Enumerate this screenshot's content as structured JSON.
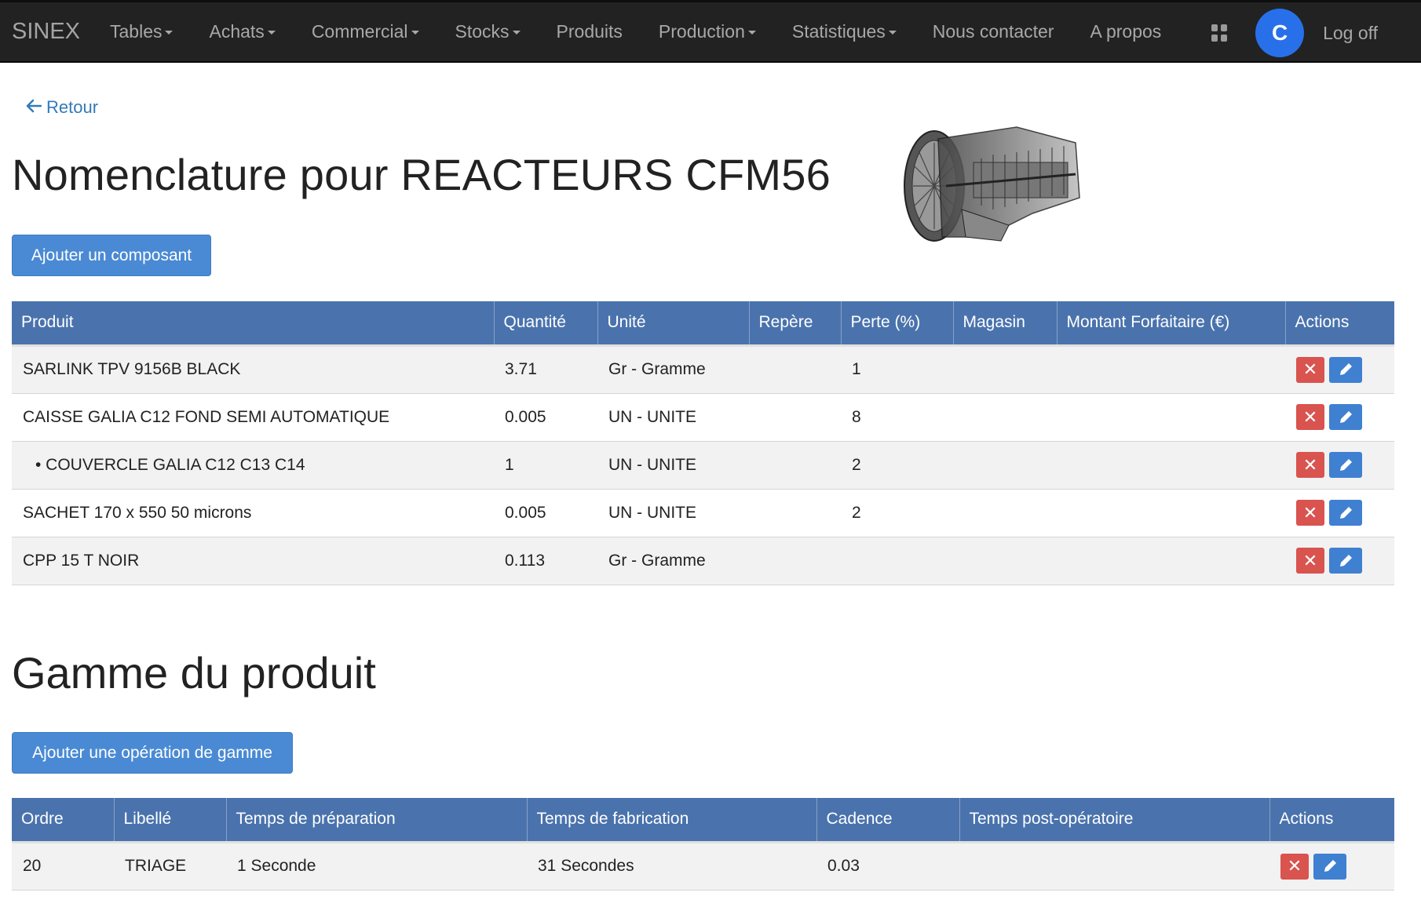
{
  "nav": {
    "brand": "SINEX",
    "items": [
      {
        "label": "Tables",
        "dropdown": true
      },
      {
        "label": "Achats",
        "dropdown": true
      },
      {
        "label": "Commercial",
        "dropdown": true
      },
      {
        "label": "Stocks",
        "dropdown": true
      },
      {
        "label": "Produits",
        "dropdown": false
      },
      {
        "label": "Production",
        "dropdown": true
      },
      {
        "label": "Statistiques",
        "dropdown": true
      },
      {
        "label": "Nous contacter",
        "dropdown": false
      },
      {
        "label": "A propos",
        "dropdown": false
      }
    ],
    "avatar_initial": "C",
    "logoff": "Log off",
    "avatar_color": "#2770e9"
  },
  "back": {
    "label": "Retour"
  },
  "title": "Nomenclature pour REACTEURS CFM56",
  "add_component_button": "Ajouter un composant",
  "bom_table": {
    "headers": [
      "Produit",
      "Quantité",
      "Unité",
      "Repère",
      "Perte (%)",
      "Magasin",
      "Montant Forfaitaire (€)",
      "Actions"
    ],
    "rows": [
      {
        "produit": "SARLINK TPV 9156B BLACK",
        "quantite": "3.71",
        "unite": "Gr - Gramme",
        "repere": "",
        "perte": "1",
        "magasin": "",
        "montant": ""
      },
      {
        "produit": "CAISSE GALIA C12 FOND SEMI AUTOMATIQUE",
        "quantite": "0.005",
        "unite": "UN - UNITE",
        "repere": "",
        "perte": "8",
        "magasin": "",
        "montant": ""
      },
      {
        "produit": "• COUVERCLE GALIA C12 C13 C14",
        "quantite": "1",
        "unite": "UN - UNITE",
        "repere": "",
        "perte": "2",
        "magasin": "",
        "montant": ""
      },
      {
        "produit": "SACHET 170 x 550 50 microns",
        "quantite": "0.005",
        "unite": "UN - UNITE",
        "repere": "",
        "perte": "2",
        "magasin": "",
        "montant": ""
      },
      {
        "produit": "CPP 15 T NOIR",
        "quantite": "0.113",
        "unite": "Gr - Gramme",
        "repere": "",
        "perte": "",
        "magasin": "",
        "montant": ""
      }
    ]
  },
  "gamme_title": "Gamme du produit",
  "add_operation_button": "Ajouter une opération de gamme",
  "gamme_table": {
    "headers": [
      "Ordre",
      "Libellé",
      "Temps de préparation",
      "Temps de fabrication",
      "Cadence",
      "Temps post-opératoire",
      "Actions"
    ],
    "rows": [
      {
        "ordre": "20",
        "libelle": "TRIAGE",
        "preparation": "1 Seconde",
        "fabrication": "31 Secondes",
        "cadence": "0.03",
        "post": ""
      }
    ]
  },
  "icons": {
    "delete": "close-icon",
    "edit": "pencil-icon",
    "apps": "grid-icon",
    "back": "arrow-left-icon"
  }
}
